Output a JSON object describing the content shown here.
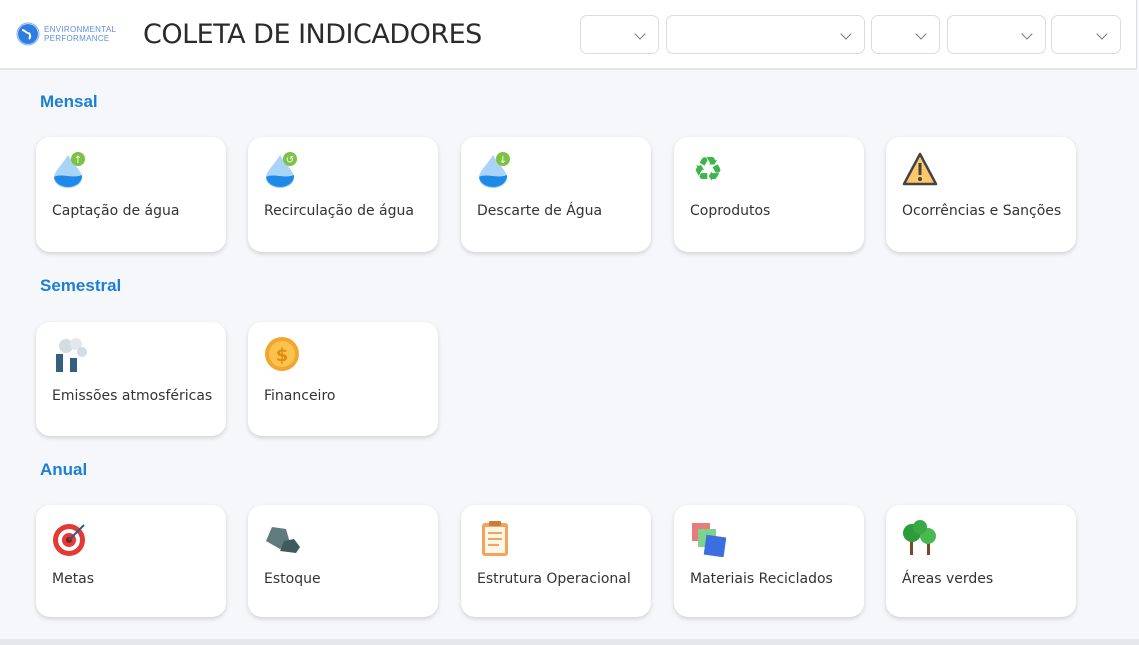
{
  "header": {
    "logo_line1": "ENVIRONMENTAL",
    "logo_line2": "PERFORMANCE",
    "title": "COLETA DE INDICADORES"
  },
  "filters": [
    {
      "value": ""
    },
    {
      "value": ""
    },
    {
      "value": ""
    },
    {
      "value": ""
    },
    {
      "value": ""
    }
  ],
  "sections": [
    {
      "title": "Mensal",
      "cards": [
        {
          "label": "Captação de água",
          "icon": "water-drop-up-icon"
        },
        {
          "label": "Recirculação de água",
          "icon": "water-drop-recycle-icon"
        },
        {
          "label": "Descarte de Água",
          "icon": "water-drop-down-icon"
        },
        {
          "label": "Coprodutos",
          "icon": "recycle-icon"
        },
        {
          "label": "Ocorrências e Sanções",
          "icon": "warning-icon"
        }
      ]
    },
    {
      "title": "Semestral",
      "cards": [
        {
          "label": "Emissões atmosféricas",
          "icon": "factory-icon"
        },
        {
          "label": "Financeiro",
          "icon": "coin-icon"
        }
      ]
    },
    {
      "title": "Anual",
      "cards": [
        {
          "label": "Metas",
          "icon": "target-icon"
        },
        {
          "label": "Estoque",
          "icon": "rocks-icon"
        },
        {
          "label": "Estrutura Operacional",
          "icon": "clipboard-icon"
        },
        {
          "label": "Materiais Reciclados",
          "icon": "materials-icon"
        },
        {
          "label": "Áreas verdes",
          "icon": "trees-icon"
        }
      ]
    }
  ]
}
